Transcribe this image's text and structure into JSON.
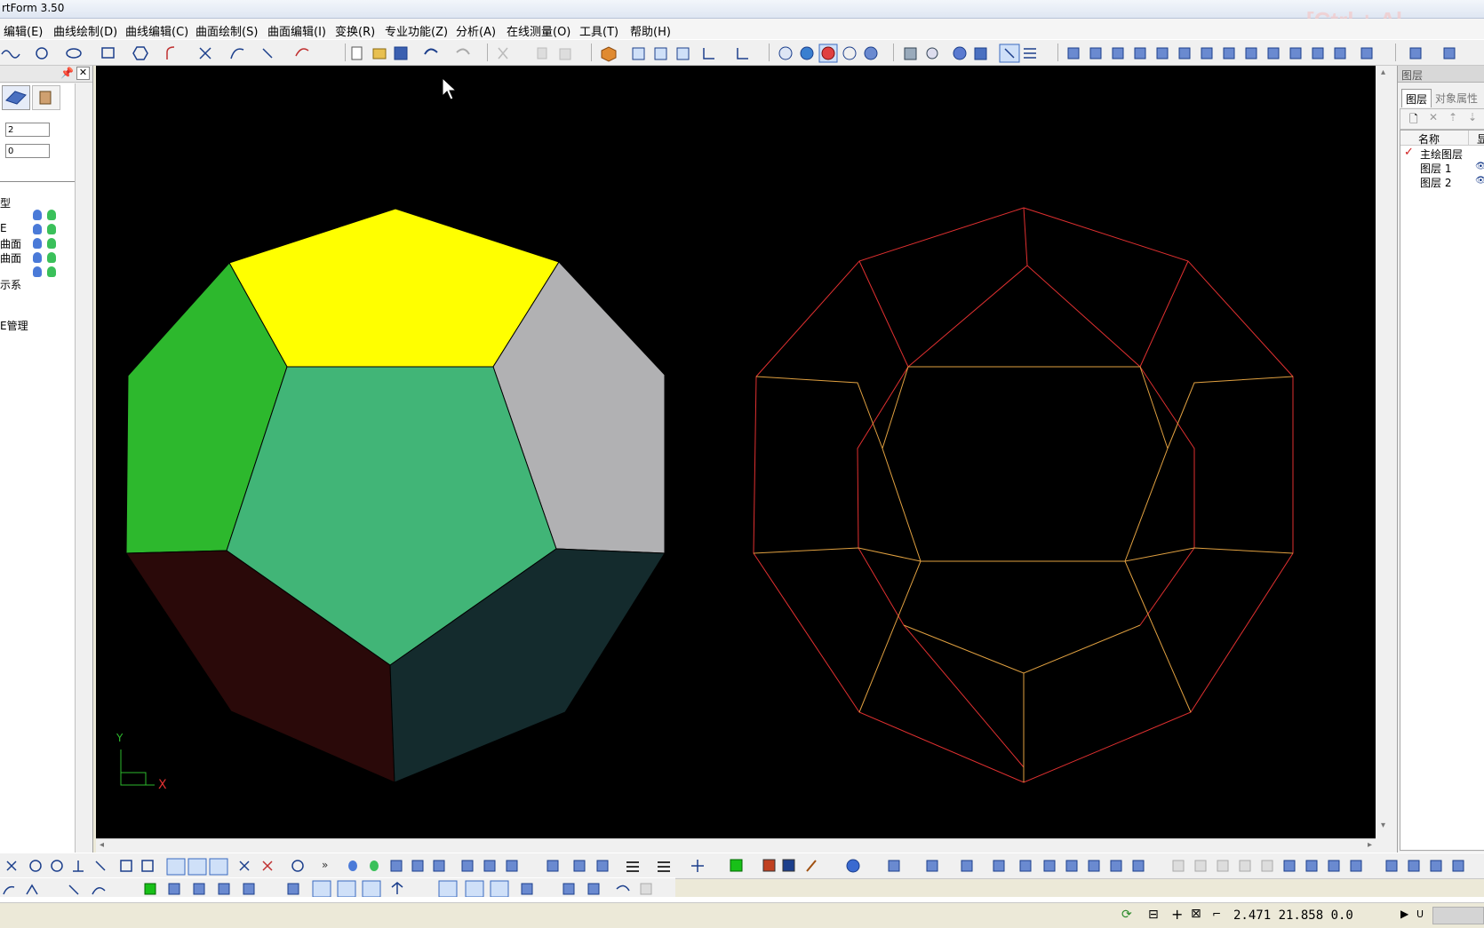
{
  "app": {
    "title": "rtForm 3.50",
    "watermark": "[Ctrl + Al"
  },
  "menu": [
    "编辑(E)",
    "曲线绘制(D)",
    "曲线编辑(C)",
    "曲面绘制(S)",
    "曲面编辑(I)",
    "变换(R)",
    "专业功能(Z)",
    "分析(A)",
    "在线测量(O)",
    "工具(T)",
    "帮助(H)"
  ],
  "left_panel": {
    "field1": "2",
    "field2": "0",
    "tree": [
      "型",
      "E",
      "曲面",
      "曲面",
      "示系",
      "E管理"
    ]
  },
  "right_panel": {
    "title": "图层",
    "tabs": [
      "图层",
      "对象属性"
    ],
    "columns": [
      "名称",
      "显"
    ],
    "layers": [
      {
        "name": "主绘图层",
        "active": true
      },
      {
        "name": "图层 1",
        "active": false
      },
      {
        "name": "图层 2",
        "active": false
      }
    ]
  },
  "viewport": {
    "background": "#000000",
    "axis_x": "X",
    "axis_y": "Y",
    "colors": {
      "top": "#ffff00",
      "left": "#2db82d",
      "right": "#b1b1b3",
      "center": "#41b577",
      "bottom_left": "#2a0909",
      "bottom_right": "#142b2d",
      "wire_outer": "#e03030",
      "wire_inner": "#e0a040"
    }
  },
  "status": {
    "coords": "2.471 21.858 0.0",
    "unit": "U"
  }
}
